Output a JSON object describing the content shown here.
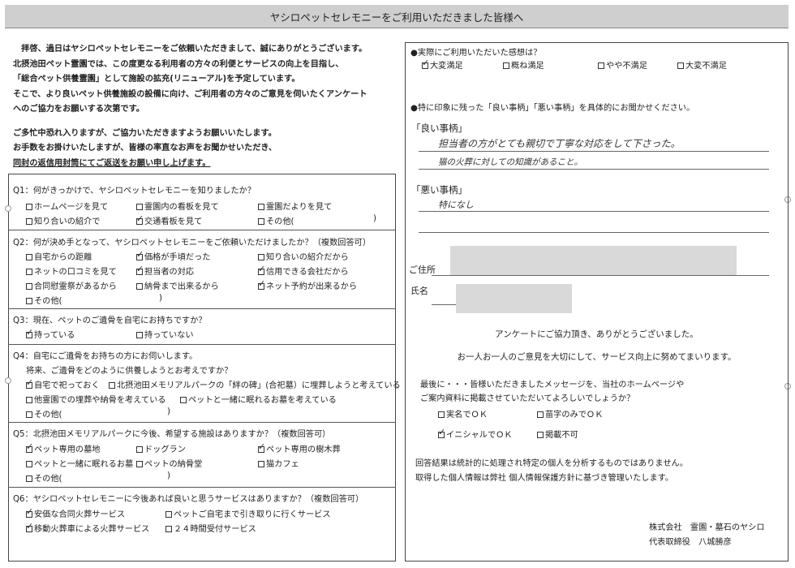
{
  "header": {
    "title": "ヤシロペットセレモニーをご利用いただきました皆様へ"
  },
  "intro": {
    "lines": [
      "　拝啓、過日はヤシロペットセレモニーをご依頼いただきまして、誠にありがとうございます。",
      "北摂池田ペット霊園では、この度更なる利用者の方々の利便とサービスの向上を目指し、",
      "「総合ペット供養霊園」として施設の拡充(リニューアル)を予定しています。",
      "そこで、より良いペット供養施設の設備に向け、ご利用者の方々のご意見を伺いたくアンケート",
      "へのご協力をお願いする次第です。"
    ],
    "lines2": [
      "ご多忙中恐れ入りますが、ご協力いただきますようお願いいたします。",
      "お手数をお掛けいたしますが、皆様の率直なお声をお聞かせいただき、"
    ],
    "underline": "同封の返信用封筒にてご返送をお願い申し上げます。"
  },
  "q1": {
    "question": "Q1：何がきっかけで、ヤシロペットセレモニーを知りましたか？",
    "options": [
      "ホームページを見て",
      "霊園内の看板を見て",
      "霊園だよりを見て",
      "知り合いの紹介で",
      "交通看板を見て",
      "その他("
    ],
    "close": ")"
  },
  "q2": {
    "question": "Q2：何が決め手となって、ヤシロペットセレモニーをご依頼いただけましたか？（複数回答可）",
    "options": [
      "自宅からの距離",
      "価格が手頃だった",
      "知り合いの紹介だから",
      "ネットの口コミを見て",
      "担当者の対応",
      "信用できる会社だから",
      "合同慰霊祭があるから",
      "納骨まで出来るから",
      "ネット予約が出来るから",
      "その他("
    ],
    "close": ")"
  },
  "q3": {
    "question": "Q3：現在、ペットのご遺骨を自宅にお持ちですか？",
    "options": [
      "持っている",
      "持っていない"
    ]
  },
  "q4": {
    "question": "Q4：自宅にご遺骨をお持ちの方にお伺いします。",
    "question2": "将来、ご遺骨をどのように供養しようとお考えですか？",
    "options": [
      "自宅で祀っておく",
      "北摂池田メモリアルパークの「絆の碑」(合祀墓）に埋葬しようと考えている",
      "他霊園での埋葬や納骨を考えている",
      "ペットと一緒に眠れるお墓を考えている",
      "その他("
    ],
    "close": ")"
  },
  "q5": {
    "question": "Q5：北摂池田メモリアルパークに今後、希望する施設はありますか？（複数回答可）",
    "options": [
      "ペット専用の墓地",
      "ドッグラン",
      "ペット専用の樹木葬",
      "ペットと一緒に眠れるお墓",
      "ペットの納骨堂",
      "猫カフェ",
      "その他("
    ],
    "close": ")"
  },
  "q6": {
    "question": "Q6：ヤシロペットセレモニーに今後あれば良いと思うサービスはありますか？（複数回答可）",
    "options": [
      "安価な合同火葬サービス",
      "ペットご自宅まで引き取りに行くサービス",
      "移動火葬車による火葬サービス",
      "２４時間受付サービス"
    ]
  },
  "impressions": {
    "question": "●実際にご利用いただいた感想は？",
    "options": [
      "大変満足",
      "概ね満足",
      "やや不満足",
      "大変不満足"
    ]
  },
  "feedback": {
    "prompt": "●特に印象に残った「良い事柄」「悪い事柄」を具体的にお聞かせください。",
    "good_label": "「良い事柄」",
    "good_text_1": "担当者の方がとても親切で丁寧な対応をして下さった。",
    "good_text_2": "猫の火葬に対しての知識があること。",
    "bad_label": "「悪い事柄」",
    "bad_text": "特になし"
  },
  "contact": {
    "address_label": "ご住所",
    "name_label": "氏名"
  },
  "thanks": {
    "line1": "アンケートにご協力頂き、ありがとうございました。",
    "line2": "お一人お一人のご意見を大切にして、サービス向上に努めてまいります。"
  },
  "publish": {
    "line1": "最後に・・・皆様いただきましたメッセージを、当社のホームページや",
    "line2": "ご案内資料に掲載させていただいてよろしいでしょうか？",
    "options": [
      "実名でＯＫ",
      "苗字のみでＯＫ",
      "イニシャルでＯＫ",
      "掲載不可"
    ]
  },
  "privacy": {
    "line1": "回答結果は統計的に処理され特定の個人を分析するものではありません。",
    "line2": "取得した個人情報は弊社 個人情報保護方針に基づき管理いたします。"
  },
  "signature": {
    "company": "株式会社　霊園・墓石のヤシロ",
    "rep": "代表取締役　八城勝彦"
  }
}
